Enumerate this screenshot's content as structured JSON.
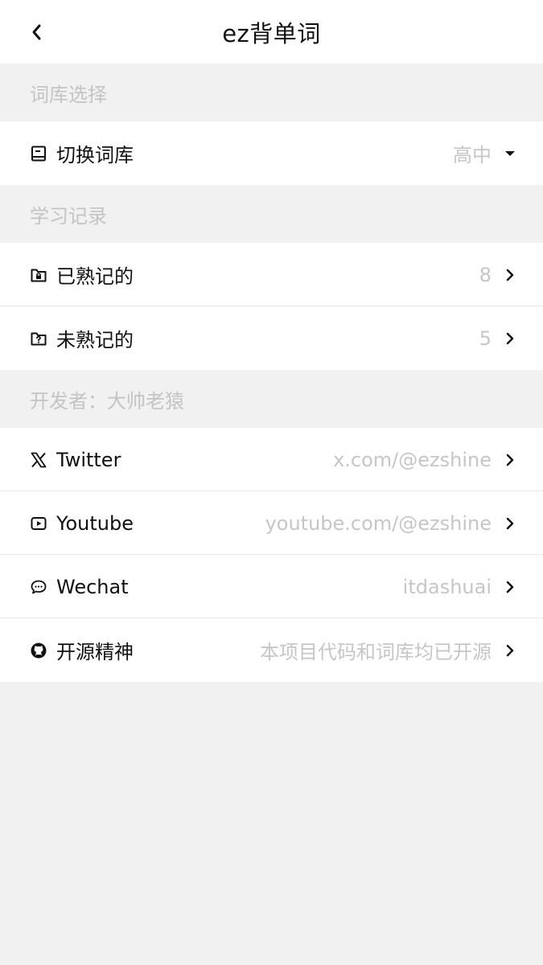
{
  "nav": {
    "title": "ez背单词",
    "back_icon": "chevron-left-icon"
  },
  "sections": {
    "library": {
      "header": "词库选择",
      "switch": {
        "icon": "book-icon",
        "label": "切换词库",
        "value": "高中",
        "trail_icon": "caret-down-icon"
      }
    },
    "records": {
      "header": "学习记录",
      "known": {
        "icon": "folder-lock-icon",
        "label": "已熟记的",
        "value": "8",
        "trail_icon": "chevron-right-icon"
      },
      "unknown": {
        "icon": "folder-question-icon",
        "label": "未熟记的",
        "value": "5",
        "trail_icon": "chevron-right-icon"
      }
    },
    "developer": {
      "header": "开发者：大帅老猿",
      "twitter": {
        "icon": "x-logo-icon",
        "label": "Twitter",
        "value": "x.com/@ezshine",
        "trail_icon": "chevron-right-icon"
      },
      "youtube": {
        "icon": "play-square-icon",
        "label": "Youtube",
        "value": "youtube.com/@ezshine",
        "trail_icon": "chevron-right-icon"
      },
      "wechat": {
        "icon": "chat-bubble-icon",
        "label": "Wechat",
        "value": "itdashuai",
        "trail_icon": "chevron-right-icon"
      },
      "opensource": {
        "icon": "github-icon",
        "label": "开源精神",
        "value": "本项目代码和词库均已开源",
        "trail_icon": "chevron-right-icon"
      }
    }
  },
  "colors": {
    "text": "#111111",
    "muted": "#c6c6c6",
    "background": "#f1f1f1",
    "surface": "#ffffff"
  }
}
